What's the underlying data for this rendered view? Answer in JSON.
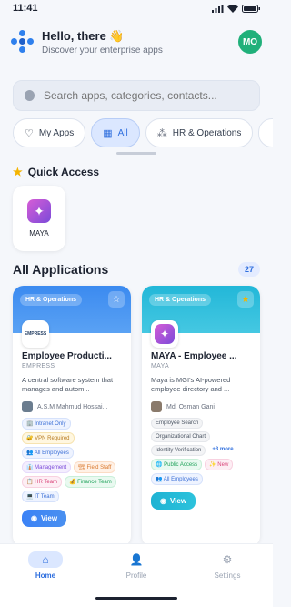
{
  "status": {
    "time": "11:41"
  },
  "header": {
    "title": "Hello, there 👋",
    "subtitle": "Discover your enterprise apps",
    "avatar": "MO"
  },
  "search": {
    "placeholder": "Search apps, categories, contacts..."
  },
  "filters": [
    {
      "label": "My Apps",
      "icon": "heart-icon"
    },
    {
      "label": "All",
      "icon": "grid-icon",
      "active": true
    },
    {
      "label": "HR & Operations",
      "icon": "dots-icon"
    }
  ],
  "quick_access": {
    "title": "Quick Access",
    "items": [
      {
        "label": "MAYA"
      }
    ]
  },
  "applications": {
    "title": "All Applications",
    "count": "27",
    "cards": [
      {
        "category": "HR & Operations",
        "favorite": false,
        "name": "Employee Producti...",
        "org": "EMPRESS",
        "logo_text": "EMPRESS",
        "description": "A central software system that manages and autom...",
        "owner": "A.S.M Mahmud Hossai...",
        "tags": [
          "🏢 Intranet Only",
          "🔐 VPN Required",
          "👥 All Employees",
          "👔 Management",
          "🏗 Field Staff",
          "📋 HR Team",
          "💰 Finance Team",
          "💻 IT Team"
        ],
        "view": "View"
      },
      {
        "category": "HR & Operations",
        "favorite": true,
        "name": "MAYA - Employee ...",
        "org": "MAYA",
        "description": "Maya is MGI's AI-powered employee directory and ...",
        "owner": "Md. Osman Gani",
        "tags": [
          "Employee Search",
          "Organizational Chart",
          "Identity Verification",
          "+3 more",
          "🌐 Public Access",
          "✨ New",
          "👥 All Employees"
        ],
        "view": "View"
      }
    ]
  },
  "nav": [
    {
      "label": "Home",
      "icon": "home-icon",
      "active": true
    },
    {
      "label": "Profile",
      "icon": "person-icon"
    },
    {
      "label": "Settings",
      "icon": "gear-icon"
    }
  ],
  "colors": {
    "accent": "#2f6fde",
    "card_blue": "#3b8af0",
    "card_cyan": "#22b7d8",
    "avatar": "#20b07a"
  }
}
